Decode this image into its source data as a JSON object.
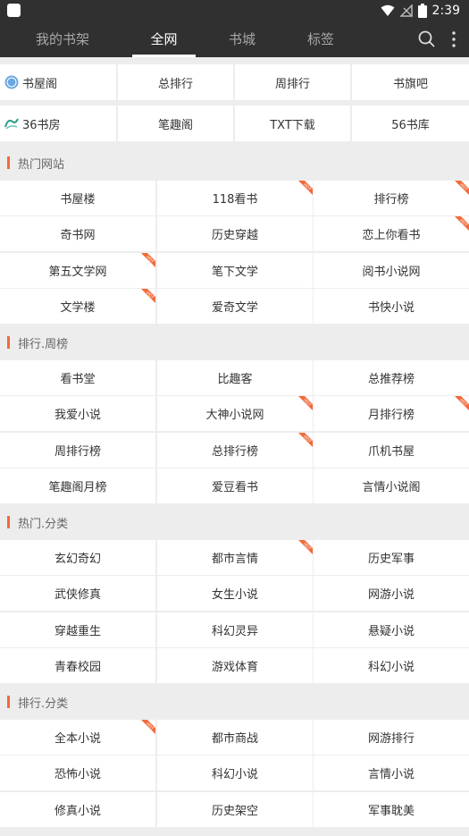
{
  "status_bar": {
    "time": "2:39",
    "battery_level": "2"
  },
  "tabs": [
    {
      "label": "我的书架",
      "active": false
    },
    {
      "label": "全网",
      "active": true
    },
    {
      "label": "书城",
      "active": false
    },
    {
      "label": "标签",
      "active": false
    }
  ],
  "icons": {
    "search": "search-icon",
    "more": "more-vert-icon"
  },
  "shortcuts": {
    "row1": [
      "书屋阁",
      "总排行",
      "周排行",
      "书旗吧"
    ],
    "row2": [
      "36书房",
      "笔趣阁",
      "TXT下载",
      "56书库"
    ]
  },
  "sections": [
    {
      "title": "热门网站",
      "items": [
        "书屋楼",
        "118看书",
        "排行榜",
        "奇书网",
        "历史穿越",
        "恋上你看书",
        "第五文学网",
        "笔下文学",
        "阅书小说网",
        "文学楼",
        "爱奇文学",
        "书快小说"
      ],
      "hot": [
        false,
        true,
        true,
        false,
        false,
        true,
        true,
        false,
        false,
        true,
        false,
        false
      ]
    },
    {
      "title": "排行.周榜",
      "items": [
        "看书堂",
        "比趣客",
        "总推荐榜",
        "我爱小说",
        "大神小说网",
        "月排行榜",
        "周排行榜",
        "总排行榜",
        "爪机书屋",
        "笔趣阁月榜",
        "爱豆看书",
        "言情小说阁"
      ],
      "hot": [
        false,
        false,
        false,
        false,
        true,
        true,
        false,
        true,
        false,
        false,
        false,
        false
      ]
    },
    {
      "title": "热门.分类",
      "items": [
        "玄幻奇幻",
        "都市言情",
        "历史军事",
        "武侠修真",
        "女生小说",
        "网游小说",
        "穿越重生",
        "科幻灵异",
        "悬疑小说",
        "青春校园",
        "游戏体育",
        "科幻小说"
      ],
      "hot": [
        false,
        true,
        false,
        false,
        false,
        false,
        false,
        false,
        false,
        false,
        false,
        false
      ]
    },
    {
      "title": "排行.分类",
      "items": [
        "全本小说",
        "都市商战",
        "网游排行",
        "恐怖小说",
        "科幻小说",
        "言情小说",
        "修真小说",
        "历史架空",
        "军事耽美"
      ],
      "hot": [
        true,
        false,
        false,
        false,
        false,
        false,
        false,
        false,
        false
      ]
    }
  ],
  "hot_badge_text": "HOT",
  "colors": {
    "topbar": "#303030",
    "accent": "#f26a3a",
    "background": "#ededed"
  }
}
